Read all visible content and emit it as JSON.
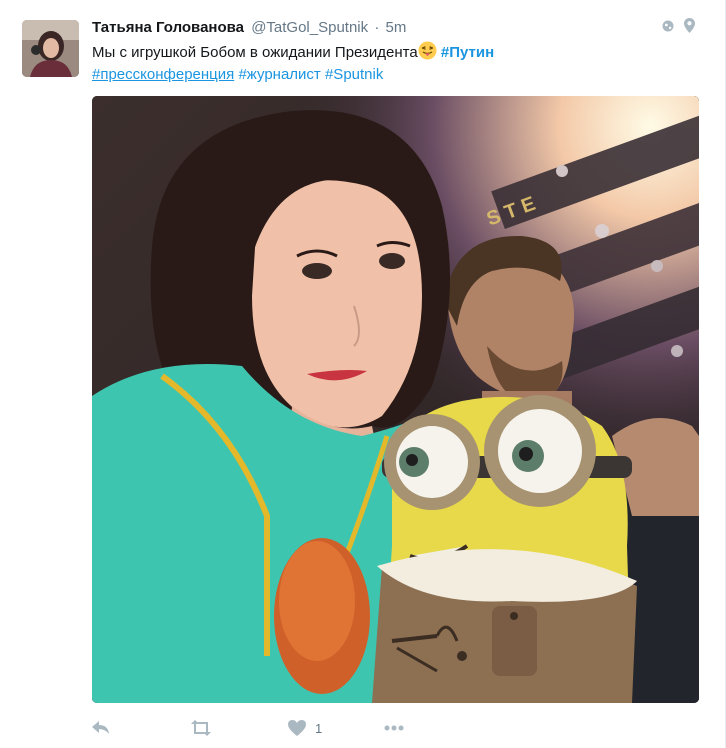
{
  "tweet": {
    "fullname": "Татьяна Голованова",
    "username": "@TatGol_Sputnik",
    "separator": "·",
    "time": "5m",
    "text_main": "Мы с игрушкой Бобом в ожидании Президента",
    "hashtags": {
      "putin": "#Путин",
      "press": "#прессконференция",
      "journalist": "#журналист",
      "sputnik": "#Sputnik"
    },
    "emoji": "face-with-tongue-icon",
    "like_count": "1"
  },
  "icons": {
    "globe": "globe-icon",
    "location": "location-pin-icon",
    "reply": "reply-icon",
    "retweet": "retweet-icon",
    "like": "heart-icon",
    "more": "more-icon"
  },
  "colors": {
    "link": "#1b95e0",
    "muted": "#657786",
    "icon": "#aab8c2"
  }
}
